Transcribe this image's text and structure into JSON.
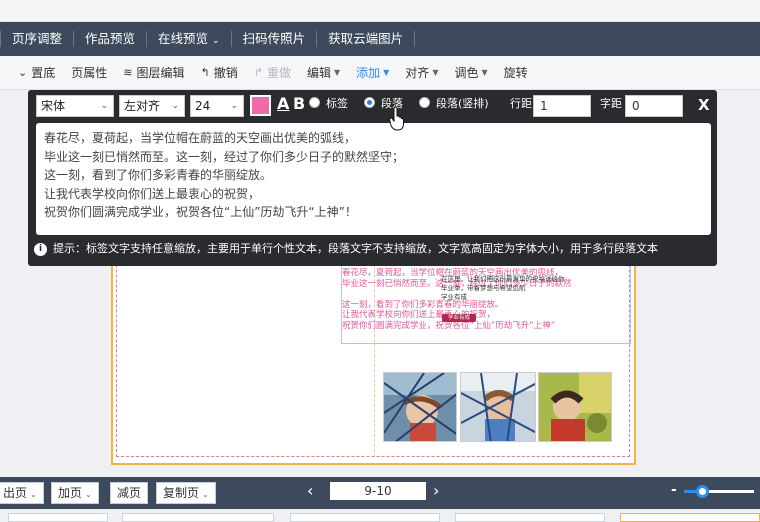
{
  "menubar": {
    "items": [
      {
        "label": "页序调整",
        "dropdown": false
      },
      {
        "label": "作品预览",
        "dropdown": false
      },
      {
        "label": "在线预览",
        "dropdown": true
      },
      {
        "label": "扫码传照片",
        "dropdown": false
      },
      {
        "label": "获取云端图片",
        "dropdown": false
      }
    ]
  },
  "toolbar": {
    "items": [
      {
        "label": "置底",
        "icon": "chevron-down-icon",
        "state": "normal",
        "dropdown": false
      },
      {
        "label": "页属性",
        "icon": "",
        "state": "normal",
        "dropdown": false
      },
      {
        "label": "图层编辑",
        "icon": "layers-icon",
        "state": "normal",
        "dropdown": false
      },
      {
        "label": "撤销",
        "icon": "undo-icon",
        "state": "normal",
        "dropdown": false
      },
      {
        "label": "重做",
        "icon": "redo-icon",
        "state": "disabled",
        "dropdown": false
      },
      {
        "label": "编辑",
        "icon": "",
        "state": "normal",
        "dropdown": true
      },
      {
        "label": "添加",
        "icon": "",
        "state": "active",
        "dropdown": true
      },
      {
        "label": "对齐",
        "icon": "",
        "state": "normal",
        "dropdown": true
      },
      {
        "label": "调色",
        "icon": "",
        "state": "normal",
        "dropdown": true
      },
      {
        "label": "旋转",
        "icon": "",
        "state": "normal",
        "dropdown": false
      }
    ]
  },
  "editor": {
    "font": "宋体",
    "align": "左对齐",
    "size": "24",
    "color": "#f06aa8",
    "underline_glyph": "A",
    "bold_glyph": "B",
    "mode_options": [
      {
        "label": "标签",
        "selected": false
      },
      {
        "label": "段落",
        "selected": true
      },
      {
        "label": "段落(竖排)",
        "selected": false
      }
    ],
    "line_spacing_label": "行距",
    "line_spacing_value": "1",
    "char_spacing_label": "字距",
    "char_spacing_value": "0",
    "close_label": "X",
    "text_lines": [
      "春花尽，夏荷起，当学位帽在蔚蓝的天空画出优美的弧线，",
      "毕业这一刻已悄然而至。这一刻，经过了你们多少日子的默然坚守；",
      "这一刻，看到了你们多彩青春的华丽绽放。",
      "让我代表学校向你们送上最衷心的祝贺，",
      "祝贺你们圆满完成学业，祝贺各位“上仙”历劫飞升“上神”！"
    ],
    "tip": "提示：标签文字支持任意缩放，主要用于单行个性文本，段落文字不支持缩放，文字宽高固定为字体大小，用于多行段落文本"
  },
  "canvas": {
    "pink_lines": [
      "春花尽，夏荷起，当学位帽在蔚蓝的天空画出优美的弧线，",
      "毕业这一刻已悄然而至。这一刻，经过了你们多少日子的默然",
      "这一刻，看到了你们多彩青春的华丽绽放。",
      "让我代表学校向你们送上最衷心的祝贺，",
      "祝贺你们圆满完成学业，祝贺各位“上仙”历劫飞升“上神”"
    ],
    "dark_lines": [
      "在这里，让我们把这份最真挚的祝福送给你",
      "毕业季，带着梦想与希望远航",
      "学业有成"
    ],
    "seal_text": "学业有成"
  },
  "bottombar": {
    "buttons": [
      {
        "label": "出页",
        "dropdown": true
      },
      {
        "label": "加页",
        "dropdown": true
      },
      {
        "label": "减页",
        "dropdown": false
      },
      {
        "label": "复制页",
        "dropdown": true
      }
    ],
    "prev_arrow": "‹",
    "next_arrow": "›",
    "page_indicator": "9-10",
    "zoom_minus": "-",
    "zoom_level": 0.25
  }
}
